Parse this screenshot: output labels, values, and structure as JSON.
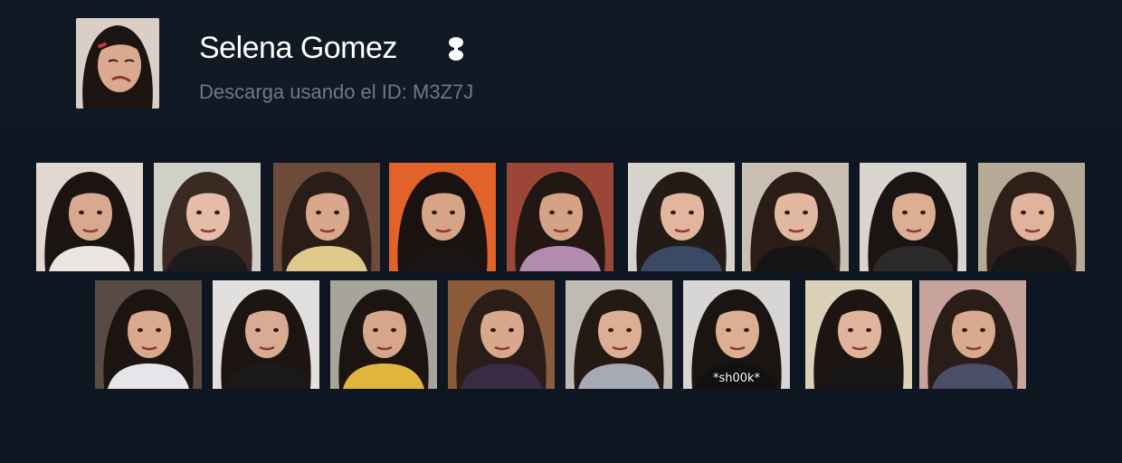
{
  "header": {
    "title": "Selena Gomez",
    "subtitle": "Descarga usando el ID: M3Z7J",
    "badge_icon": "trophy-icon",
    "avatar_icon": "sticker-thumbnail"
  },
  "stickers": {
    "row1": [
      {
        "bg": "#e2d8d2",
        "hair": "#1b1411",
        "skin": "#d8a98e",
        "cloth": "#e9e6e2",
        "caption": ""
      },
      {
        "bg": "#cfd0c8",
        "hair": "#3a2a22",
        "skin": "#e4bca7",
        "cloth": "#1c1a1a",
        "caption": ""
      },
      {
        "bg": "#6d4b3a",
        "hair": "#2a1c16",
        "skin": "#d9a88c",
        "cloth": "#e0c98a",
        "caption": ""
      },
      {
        "bg": "#e1632a",
        "hair": "#1a1210",
        "skin": "#d7a488",
        "cloth": "#1a1414",
        "caption": ""
      },
      {
        "bg": "#9b4636",
        "hair": "#221712",
        "skin": "#d6a286",
        "cloth": "#b58ab0",
        "caption": ""
      },
      {
        "bg": "#d6d3cc",
        "hair": "#241b16",
        "skin": "#e2b59c",
        "cloth": "#3a4a66",
        "caption": ""
      },
      {
        "bg": "#c9c0b3",
        "hair": "#2a1c16",
        "skin": "#e2b9a0",
        "cloth": "#141414",
        "caption": ""
      },
      {
        "bg": "#d8d4cf",
        "hair": "#1a1412",
        "skin": "#dcae93",
        "cloth": "#2a2a2a",
        "caption": ""
      },
      {
        "bg": "#b4aa96",
        "hair": "#2e1f18",
        "skin": "#e0b49a",
        "cloth": "#161616",
        "caption": ""
      }
    ],
    "row2": [
      {
        "bg": "#5a4a44",
        "hair": "#1b1411",
        "skin": "#d9a88e",
        "cloth": "#e6e6ea",
        "caption": ""
      },
      {
        "bg": "#e2e0de",
        "hair": "#1d1512",
        "skin": "#d9ab92",
        "cloth": "#1a1a1a",
        "caption": ""
      },
      {
        "bg": "#a7a49c",
        "hair": "#1c1411",
        "skin": "#d7a68c",
        "cloth": "#e0b63a",
        "caption": ""
      },
      {
        "bg": "#8a5a3a",
        "hair": "#2a1c16",
        "skin": "#d8a88d",
        "cloth": "#3a2a44",
        "caption": ""
      },
      {
        "bg": "#bfbab4",
        "hair": "#241913",
        "skin": "#dcae93",
        "cloth": "#a7a9b4",
        "caption": ""
      },
      {
        "bg": "#d8d6d4",
        "hair": "#1a1412",
        "skin": "#dcae93",
        "cloth": "#111111",
        "caption": "*sh00k*"
      },
      {
        "bg": "#ddd0b8",
        "hair": "#1d1512",
        "skin": "#e0b49a",
        "cloth": "#161616",
        "caption": ""
      },
      {
        "bg": "#c7a39b",
        "hair": "#2a1c16",
        "skin": "#d8a98e",
        "cloth": "#4a4e66",
        "caption": ""
      }
    ]
  }
}
